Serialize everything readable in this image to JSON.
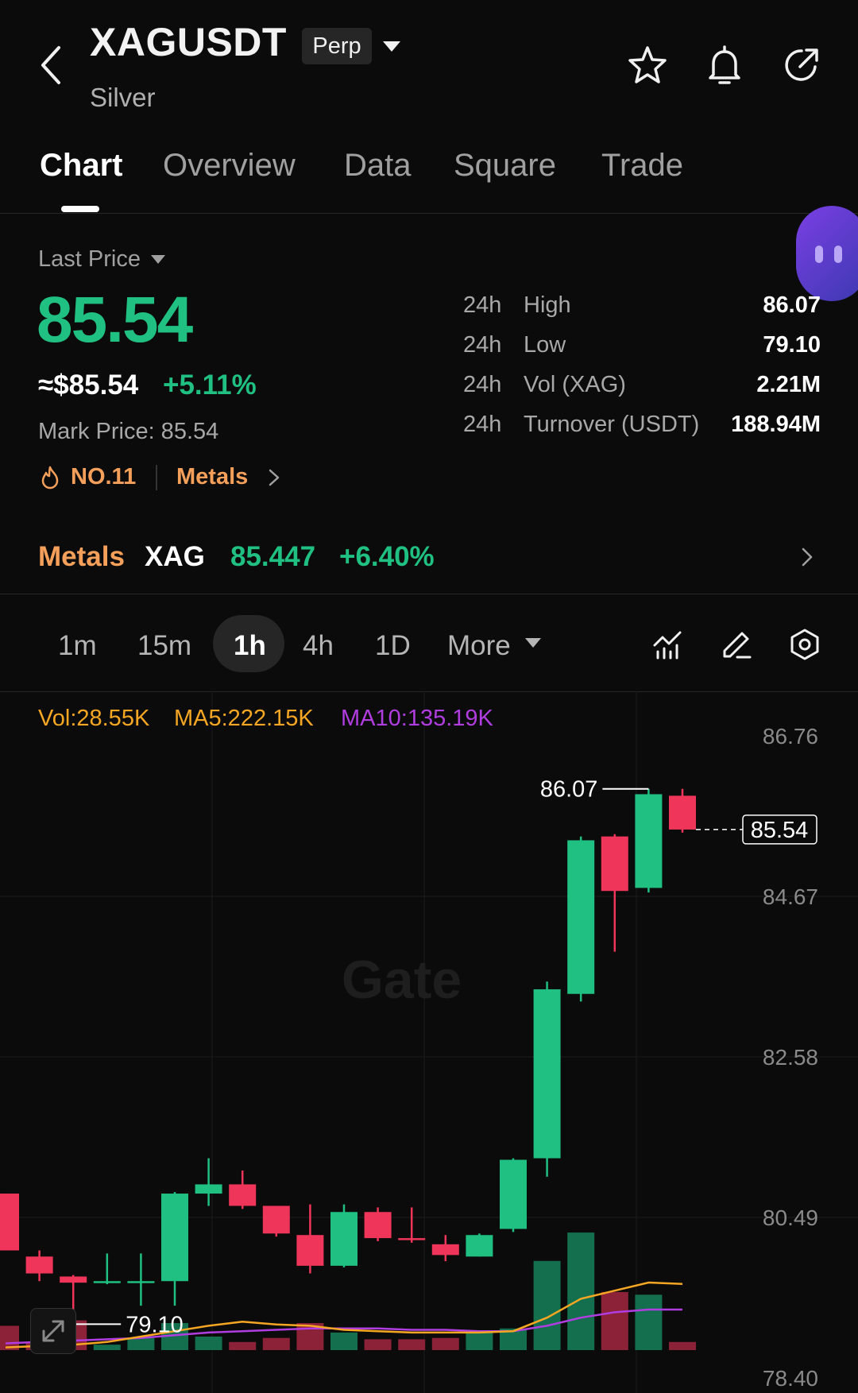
{
  "header": {
    "symbol": "XAGUSDT",
    "contract_type": "Perp",
    "subtitle": "Silver"
  },
  "tabs": [
    {
      "label": "Chart",
      "active": true
    },
    {
      "label": "Overview",
      "active": false
    },
    {
      "label": "Data",
      "active": false
    },
    {
      "label": "Square",
      "active": false
    },
    {
      "label": "Trade",
      "active": false
    }
  ],
  "price": {
    "label": "Last Price",
    "last": "85.54",
    "usd": "≈$85.54",
    "change": "+5.11%",
    "mark": "Mark Price: 85.54",
    "rank": "NO.11",
    "category": "Metals"
  },
  "stats": [
    {
      "period": "24h",
      "name": "High",
      "value": "86.07"
    },
    {
      "period": "24h",
      "name": "Low",
      "value": "79.10"
    },
    {
      "period": "24h",
      "name": "Vol (XAG)",
      "value": "2.21M"
    },
    {
      "period": "24h",
      "name": "Turnover (USDT)",
      "value": "188.94M"
    }
  ],
  "metals_bar": {
    "label": "Metals",
    "symbol": "XAG",
    "price": "85.447",
    "change": "+6.40%"
  },
  "intervals": [
    {
      "label": "1m",
      "active": false
    },
    {
      "label": "15m",
      "active": false
    },
    {
      "label": "1h",
      "active": true
    },
    {
      "label": "4h",
      "active": false
    },
    {
      "label": "1D",
      "active": false
    },
    {
      "label": "More",
      "active": false
    }
  ],
  "colors": {
    "up": "#1fc081",
    "down": "#f0355a",
    "accent": "#f5a05a",
    "ma5": "#f5a623",
    "ma10": "#b03de0"
  },
  "chart_data": {
    "type": "candlestick",
    "volume_legend": {
      "vol": "Vol:28.55K",
      "ma5": "MA5:222.15K",
      "ma10": "MA10:135.19K"
    },
    "y_ticks": [
      "86.76",
      "84.67",
      "82.58",
      "80.49",
      "78.40"
    ],
    "ylim": [
      78.4,
      86.76
    ],
    "current_price_label": "85.54",
    "high_label": "86.07",
    "low_label": "79.10",
    "watermark": "Gate",
    "candles": [
      {
        "o": 80.8,
        "h": 80.8,
        "c": 80.06,
        "l": 80.06
      },
      {
        "o": 79.98,
        "h": 80.06,
        "c": 79.76,
        "l": 79.66
      },
      {
        "o": 79.72,
        "h": 79.74,
        "c": 79.64,
        "l": 79.1
      },
      {
        "o": 79.66,
        "h": 80.02,
        "c": 79.66,
        "l": 79.62
      },
      {
        "o": 79.66,
        "h": 80.02,
        "c": 79.66,
        "l": 79.34
      },
      {
        "o": 79.66,
        "h": 80.82,
        "c": 80.8,
        "l": 79.34
      },
      {
        "o": 80.8,
        "h": 81.26,
        "c": 80.92,
        "l": 80.64
      },
      {
        "o": 80.92,
        "h": 81.1,
        "c": 80.64,
        "l": 80.6
      },
      {
        "o": 80.64,
        "h": 80.64,
        "c": 80.28,
        "l": 80.24
      },
      {
        "o": 80.26,
        "h": 80.66,
        "c": 79.86,
        "l": 79.76
      },
      {
        "o": 79.86,
        "h": 80.66,
        "c": 80.56,
        "l": 79.84
      },
      {
        "o": 80.56,
        "h": 80.62,
        "c": 80.22,
        "l": 80.18
      },
      {
        "o": 80.22,
        "h": 80.62,
        "c": 80.2,
        "l": 80.16
      },
      {
        "o": 80.14,
        "h": 80.26,
        "c": 80.0,
        "l": 79.92
      },
      {
        "o": 79.98,
        "h": 80.28,
        "c": 80.26,
        "l": 79.98
      },
      {
        "o": 80.34,
        "h": 81.26,
        "c": 81.24,
        "l": 80.3
      },
      {
        "o": 81.26,
        "h": 83.56,
        "c": 83.46,
        "l": 81.02
      },
      {
        "o": 83.4,
        "h": 85.45,
        "c": 85.4,
        "l": 83.3
      },
      {
        "o": 85.45,
        "h": 85.48,
        "c": 84.74,
        "l": 83.95
      },
      {
        "o": 84.78,
        "h": 86.07,
        "c": 86.0,
        "l": 84.72
      },
      {
        "o": 85.98,
        "h": 86.07,
        "c": 85.54,
        "l": 85.5
      }
    ],
    "volumes": [
      0.18,
      0.05,
      0.22,
      0.04,
      0.09,
      0.2,
      0.1,
      0.06,
      0.09,
      0.2,
      0.13,
      0.08,
      0.08,
      0.09,
      0.14,
      0.16,
      0.66,
      0.87,
      0.43,
      0.41,
      0.06
    ],
    "ma5_line": [
      0.02,
      0.03,
      0.04,
      0.06,
      0.1,
      0.14,
      0.18,
      0.21,
      0.19,
      0.18,
      0.15,
      0.14,
      0.13,
      0.13,
      0.13,
      0.14,
      0.24,
      0.38,
      0.44,
      0.5,
      0.49
    ],
    "ma10_line": [
      0.05,
      0.06,
      0.07,
      0.08,
      0.09,
      0.11,
      0.13,
      0.14,
      0.15,
      0.16,
      0.16,
      0.16,
      0.15,
      0.15,
      0.14,
      0.14,
      0.18,
      0.24,
      0.28,
      0.3,
      0.3
    ]
  }
}
